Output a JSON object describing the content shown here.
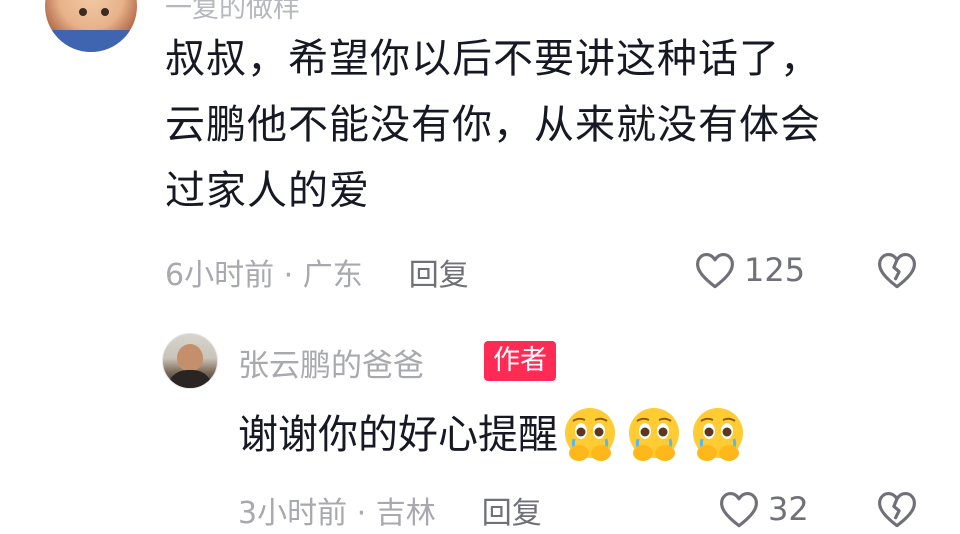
{
  "top_comment": {
    "username_partial": "一复的做样",
    "text_lines": [
      "叔叔，希望你以后不要讲这种话了，",
      "云鹏他不能没有你，从来就没有体会",
      "过家人的爱"
    ],
    "meta": "6小时前 · 广东",
    "reply_label": "回复",
    "like_count": "125"
  },
  "reply_comment": {
    "username": "张云鹏的爸爸",
    "badge": "作者",
    "text": "谢谢你的好心提醒",
    "emoji_name": "pleading-face-with-hands-emoji",
    "emoji_count": 3,
    "meta": "3小时前 · 吉林",
    "reply_label": "回复",
    "like_count": "32"
  },
  "colors": {
    "badge_bg": "#fe2c55",
    "text": "#161823",
    "meta_text": "#a8a9ae",
    "icon": "#6f7078"
  }
}
